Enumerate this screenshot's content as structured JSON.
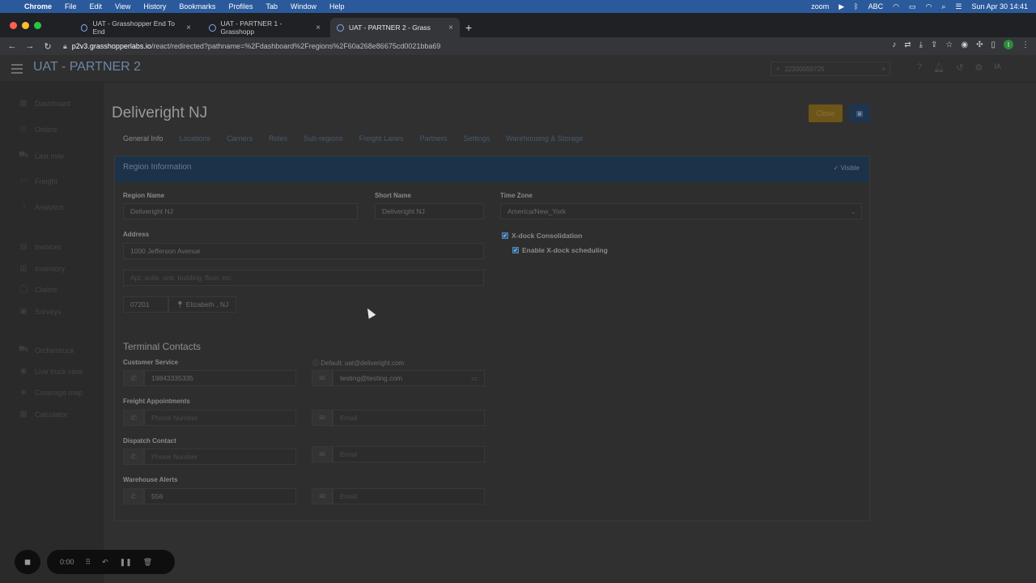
{
  "menubar": {
    "app": "Chrome",
    "items": [
      "File",
      "Edit",
      "View",
      "History",
      "Bookmarks",
      "Profiles",
      "Tab",
      "Window",
      "Help"
    ],
    "zoom": "zoom",
    "abc": "ABC",
    "datetime": "Sun Apr 30  14:41"
  },
  "tabs": [
    {
      "title": "UAT - Grasshopper End To End"
    },
    {
      "title": "UAT - PARTNER 1 - Grasshopp"
    },
    {
      "title": "UAT - PARTNER 2 - Grass"
    }
  ],
  "url": {
    "host": "p2v3.grasshopperlabs.io",
    "path": "/react/redirected?pathname=%2Fdashboard%2Fregions%2F60a268e86675cd0021bba69"
  },
  "header": {
    "title": "UAT - PARTNER 2",
    "search_value": "22200050725",
    "initials": "IA"
  },
  "sidebar": {
    "items": [
      {
        "label": "Dashboard",
        "icon": "dashboard-icon",
        "glyph": "▦"
      },
      {
        "label": "Orders",
        "icon": "orders-icon",
        "glyph": "◎"
      },
      {
        "label": "Last mile",
        "icon": "last-mile-icon",
        "glyph": "⛟"
      },
      {
        "label": "Freight",
        "icon": "freight-icon",
        "glyph": "▭"
      },
      {
        "label": "Analytics",
        "icon": "analytics-icon",
        "glyph": "◔"
      },
      {
        "label": "Invoices",
        "icon": "invoices-icon",
        "glyph": "▤"
      },
      {
        "label": "Inventory",
        "icon": "inventory-icon",
        "glyph": "▥"
      },
      {
        "label": "Claims",
        "icon": "claims-icon",
        "glyph": "◯"
      },
      {
        "label": "Surveys",
        "icon": "surveys-icon",
        "glyph": "▣"
      },
      {
        "label": "Orchestruck",
        "icon": "orchestruck-icon",
        "glyph": "⛟"
      },
      {
        "label": "Live truck view",
        "icon": "live-truck-icon",
        "glyph": "◉"
      },
      {
        "label": "Coverage map",
        "icon": "coverage-map-icon",
        "glyph": "◈"
      },
      {
        "label": "Calculator",
        "icon": "calculator-icon",
        "glyph": "▦"
      }
    ]
  },
  "page": {
    "title": "Deliveright NJ",
    "close_label": "Close",
    "tabs": [
      "General Info",
      "Locations",
      "Carriers",
      "Roles",
      "Sub-regions",
      "Freight Lanes",
      "Partners",
      "Settings",
      "Warehousing & Storage"
    ],
    "panel_title": "Region Information",
    "visible_label": "Visible"
  },
  "form": {
    "region_name_label": "Region Name",
    "region_name": "Deliveright NJ",
    "short_name_label": "Short Name",
    "short_name": "Deliveright NJ",
    "time_zone_label": "Time Zone",
    "time_zone": "America/New_York",
    "address_label": "Address",
    "address": "1000 Jefferson Avenue",
    "address2_placeholder": "Apt, suite, unit, building, floor, etc.",
    "zip": "07201",
    "city": "Elizabeth , NJ",
    "xdock_label": "X-dock Consolidation",
    "xdock_sched_label": "Enable X-dock scheduling"
  },
  "contacts": {
    "section_title": "Terminal Contacts",
    "default_hint": "Default: uat@deliveright.com",
    "rows": [
      {
        "label": "Customer Service",
        "phone": "19843335335",
        "email": "testing@testing.com"
      },
      {
        "label": "Freight Appointments",
        "phone": "",
        "email": ""
      },
      {
        "label": "Dispatch Contact",
        "phone": "",
        "email": ""
      },
      {
        "label": "Warehouse Alerts",
        "phone": "556",
        "email": ""
      }
    ],
    "phone_placeholder": "Phone Number",
    "email_placeholder": "Email"
  },
  "recorder": {
    "time": "0:00"
  }
}
